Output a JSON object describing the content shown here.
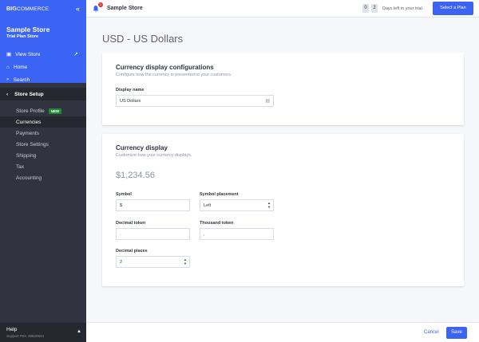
{
  "sidebar": {
    "logo_bold": "BIG",
    "logo_rest": "COMMERCE",
    "store_name": "Sample Store",
    "plan_name": "Trial Plan Store",
    "top_items": [
      {
        "label": "View Store"
      },
      {
        "label": "Home"
      },
      {
        "label": "Search"
      }
    ],
    "section_title": "Store Setup",
    "sub_items": [
      {
        "label": "Store Profile",
        "badge": "NEW"
      },
      {
        "label": "Currencies"
      },
      {
        "label": "Payments"
      },
      {
        "label": "Store Settings"
      },
      {
        "label": "Shipping"
      },
      {
        "label": "Tax"
      },
      {
        "label": "Accounting"
      }
    ],
    "help_label": "Help",
    "support_text": "Support PIN: 48820944"
  },
  "header": {
    "notification_count": "1",
    "store_name": "Sample Store",
    "days_digits": [
      "0",
      "2"
    ],
    "days_text": "Days left in your trial.",
    "plan_button": "Select a Plan"
  },
  "main": {
    "title": "USD - US Dollars",
    "config_card": {
      "title": "Currency display configurations",
      "desc": "Configure how the currency is presented to your customers.",
      "display_name_label": "Display name",
      "display_name_value": "US Dollars"
    },
    "display_card": {
      "title": "Currency display",
      "desc": "Customize how your currency displays.",
      "preview": "$1,234.56",
      "symbol_label": "Symbol",
      "symbol_value": "$",
      "placement_label": "Symbol placement",
      "placement_value": "Left",
      "decimal_token_label": "Decimal token",
      "decimal_token_value": ".",
      "thousand_token_label": "Thousand token",
      "thousand_token_value": ",",
      "decimal_places_label": "Decimal places",
      "decimal_places_value": "2"
    }
  },
  "footer": {
    "cancel": "Cancel",
    "save": "Save"
  },
  "colors": {
    "primary": "#3c64f4",
    "sidebar": "#313440",
    "sidebar_dark": "#26282f",
    "new_badge": "#208831"
  }
}
